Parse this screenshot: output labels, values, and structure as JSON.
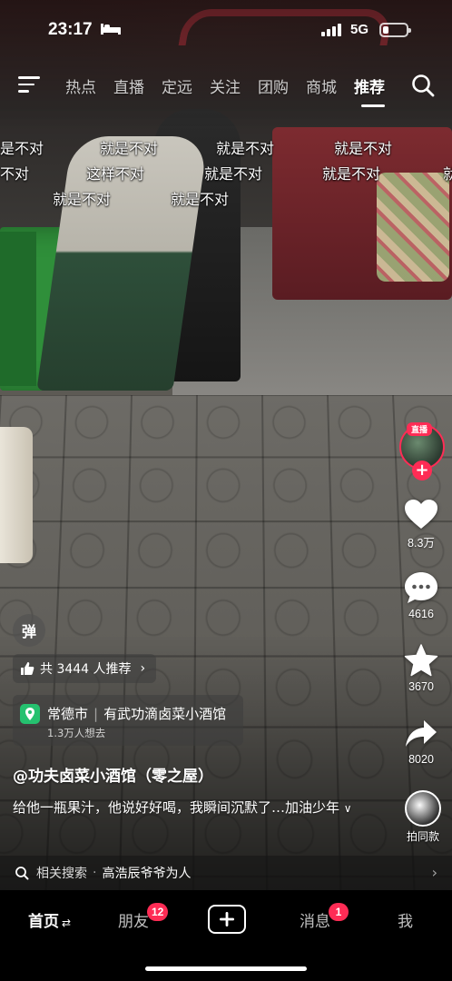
{
  "status_bar": {
    "time": "23:17",
    "network": "5G",
    "battery_level": 0.25
  },
  "top_nav": {
    "tabs": [
      "热点",
      "直播",
      "定远",
      "关注",
      "团购",
      "商城",
      "推荐"
    ],
    "active_tab": "推荐"
  },
  "danmaku": [
    "是不对",
    "就是不对",
    "就是不对",
    "就是不对",
    "不对",
    "这样不对",
    "就是不对",
    "就是不对",
    "就",
    "就是不对",
    "就是不对"
  ],
  "right_rail": {
    "live_badge": "直播",
    "follow_symbol": "+",
    "likes": "8.3万",
    "comments": "4616",
    "favorites": "3670",
    "shares": "8020",
    "same_style_label": "拍同款"
  },
  "video_info": {
    "danmu_toggle": "弹",
    "recommend_text": "共 3444 人推荐",
    "poi": {
      "city": "常德市",
      "name": "有武功滴卤菜小酒馆",
      "want_to_go": "1.3万人想去"
    },
    "author": "@功夫卤菜小酒馆（零之屋）",
    "description": "给他一瓶果汁，他说好好喝，我瞬间沉默了…加油少年",
    "description_more": "∨"
  },
  "related_search": {
    "label": "相关搜索",
    "query": "高浩辰爷爷为人"
  },
  "tab_bar": {
    "home": "首页",
    "home_switch": "⇄",
    "friends": "朋友",
    "friends_badge": "12",
    "messages": "消息",
    "messages_badge": "1",
    "me": "我"
  },
  "colors": {
    "accent": "#fe2c55",
    "poi_pin": "#25c16f"
  }
}
